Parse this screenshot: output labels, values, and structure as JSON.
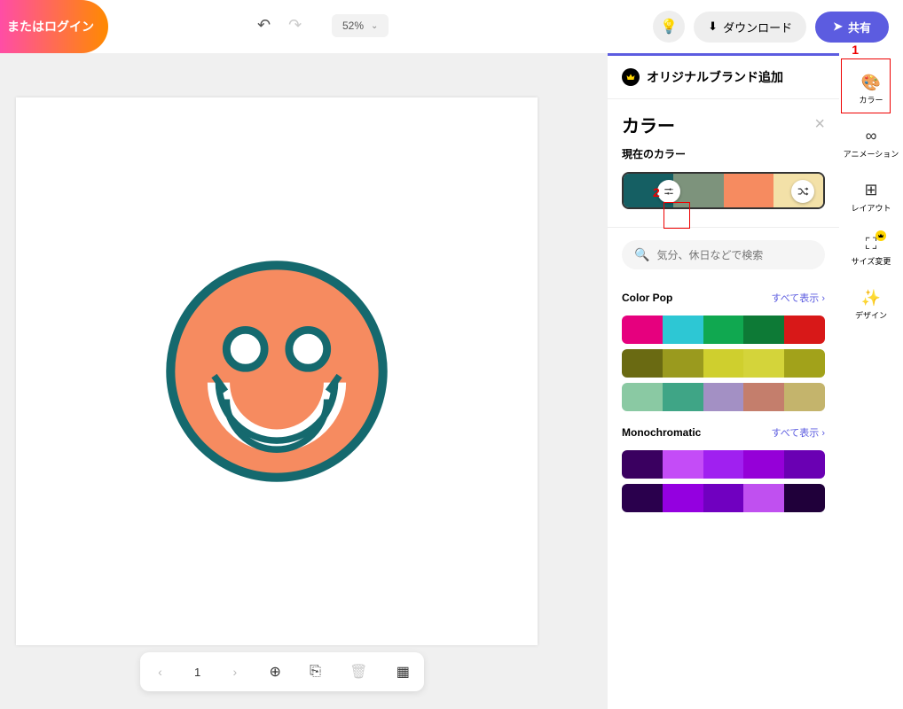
{
  "topbar": {
    "login_label": "またはログイン",
    "zoom_value": "52%",
    "download_label": "ダウンロード",
    "share_label": "共有"
  },
  "canvas": {
    "smiley_fill": "#f68b60",
    "smiley_stroke": "#15696e"
  },
  "page_nav": {
    "page_num": "1"
  },
  "panel": {
    "brand_add": "オリジナルブランド追加",
    "color_heading": "カラー",
    "current_color_label": "現在のカラー",
    "current_colors": [
      "#155f63",
      "#7d937c",
      "#f68b60",
      "#f3e1a8"
    ],
    "search_placeholder": "気分、休日などで検索",
    "view_all": "すべて表示",
    "cat1": "Color Pop",
    "palettes1": [
      [
        "#e6007e",
        "#2dc7d4",
        "#10a850",
        "#0d7a36",
        "#d81818"
      ],
      [
        "#6a6a12",
        "#9a9a1e",
        "#cfcf2e",
        "#d4d43a",
        "#a2a21a"
      ],
      [
        "#8ac9a3",
        "#3fa586",
        "#a390c4",
        "#c47e6c",
        "#c4b46c"
      ]
    ],
    "cat2": "Monochromatic",
    "palettes2": [
      [
        "#3a0060",
        "#c44cf7",
        "#a020f0",
        "#9500d8",
        "#6a00b3"
      ],
      [
        "#2a004d",
        "#9400e0",
        "#7000c0",
        "#c050f0",
        "#20003a"
      ]
    ]
  },
  "rail": {
    "color": "カラー",
    "animation": "アニメーション",
    "layout": "レイアウト",
    "resize": "サイズ変更",
    "design": "デザイン"
  },
  "annotations": {
    "a1": "1",
    "a2": "2"
  }
}
